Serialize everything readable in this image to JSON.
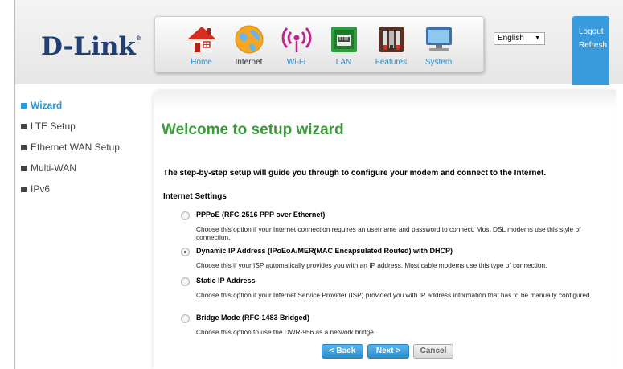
{
  "logo": {
    "text": "D-Link",
    "reg": "®"
  },
  "nav": {
    "items": [
      {
        "label": "Home",
        "icon": "home-icon"
      },
      {
        "label": "Internet",
        "icon": "globe-icon"
      },
      {
        "label": "Wi-Fi",
        "icon": "wifi-icon"
      },
      {
        "label": "LAN",
        "icon": "lan-port-icon"
      },
      {
        "label": "Features",
        "icon": "tools-icon"
      },
      {
        "label": "System",
        "icon": "computer-icon"
      }
    ],
    "active": "Internet"
  },
  "language": {
    "selected": "English"
  },
  "account": {
    "logout": "Logout",
    "refresh": "Refresh"
  },
  "sidebar": {
    "items": [
      {
        "label": "Wizard",
        "active": true
      },
      {
        "label": "LTE Setup",
        "active": false
      },
      {
        "label": "Ethernet WAN Setup",
        "active": false
      },
      {
        "label": "Multi-WAN",
        "active": false
      },
      {
        "label": "IPv6",
        "active": false
      }
    ]
  },
  "main": {
    "title": "Welcome to setup wizard",
    "intro": "The step-by-step setup will guide you through to configure your modem and connect to the Internet.",
    "section_title": "Internet Settings",
    "options": [
      {
        "label": "PPPoE (RFC-2516 PPP over Ethernet)",
        "desc": "Choose this option if your Internet connection requires an username and password to connect. Most DSL modems use this style of connection.",
        "checked": false
      },
      {
        "label": "Dynamic IP Address (IPoEoA/MER(MAC Encapsulated Routed) with DHCP)",
        "desc": "Choose this if your ISP automatically provides you with an IP address. Most cable modems use this type of connection.",
        "checked": true
      },
      {
        "label": "Static IP Address",
        "desc": "Choose this option if your Internet Service Provider (ISP) provided you with IP address information that has to be manually configured.",
        "checked": false
      },
      {
        "label": "Bridge Mode (RFC-1483 Bridged)",
        "desc": "Choose this option to use the DWR-956 as a network bridge.",
        "checked": false
      }
    ]
  },
  "buttons": {
    "back": "< Back",
    "next": "Next >",
    "cancel": "Cancel"
  },
  "colors": {
    "accent": "#2a9ad8",
    "title_green": "#3a9a3a",
    "brand_navy": "#1f3f74"
  }
}
